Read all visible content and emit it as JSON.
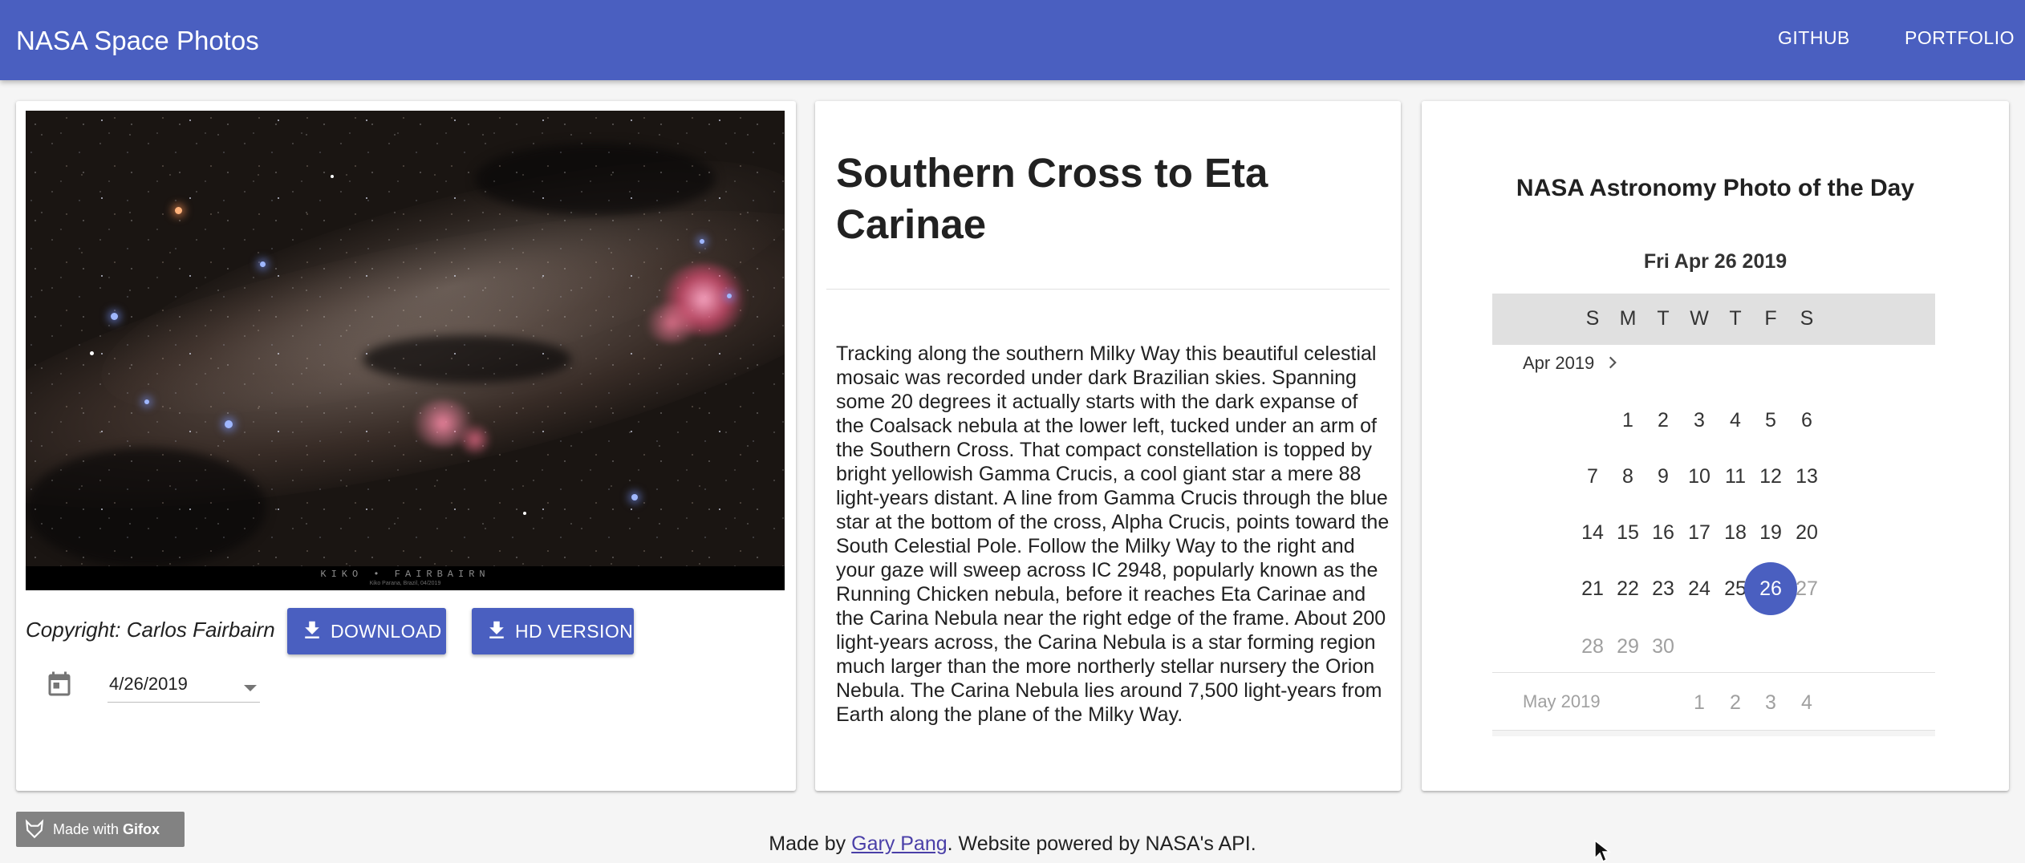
{
  "appbar": {
    "title": "NASA Space Photos",
    "links": [
      "GITHUB",
      "PORTFOLIO"
    ]
  },
  "photo_card": {
    "watermark": "KIKO • FAIRBAIRN",
    "watermark_sub": "Kiko Parana, Brazil, 04/2019",
    "copyright": "Copyright: Carlos Fairbairn",
    "download_label": "DOWNLOAD",
    "hd_label": "HD VERSION",
    "date_value": "4/26/2019"
  },
  "apod": {
    "title": "Southern Cross to Eta Carinae",
    "explanation": "Tracking along the southern Milky Way this beautiful celestial mosaic was recorded under dark Brazilian skies. Spanning some 20 degrees it actually starts with the dark expanse of the Coalsack nebula at the lower left, tucked under an arm of the Southern Cross. That compact constellation is topped by bright yellowish Gamma Crucis, a cool giant star a mere 88 light-years distant. A line from Gamma Crucis through the blue star at the bottom of the cross, Alpha Crucis, points toward the South Celestial Pole. Follow the Milky Way to the right and your gaze will sweep across IC 2948, popularly known as the Running Chicken nebula, before it reaches Eta Carinae and the Carina Nebula near the right edge of the frame. About 200 light-years across, the Carina Nebula is a star forming region much larger than the more northerly stellar nursery the Orion Nebula. The Carina Nebula lies around 7,500 light-years from Earth along the plane of the Milky Way."
  },
  "calendar": {
    "heading": "NASA Astronomy Photo of the Day",
    "selected_date_label": "Fri Apr 26 2019",
    "weekdays": [
      "S",
      "M",
      "T",
      "W",
      "T",
      "F",
      "S"
    ],
    "month_label": "Apr 2019",
    "weeks": [
      [
        "",
        "1",
        "2",
        "3",
        "4",
        "5",
        "6"
      ],
      [
        "7",
        "8",
        "9",
        "10",
        "11",
        "12",
        "13"
      ],
      [
        "14",
        "15",
        "16",
        "17",
        "18",
        "19",
        "20"
      ],
      [
        "21",
        "22",
        "23",
        "24",
        "25",
        "26",
        "27"
      ],
      [
        "28",
        "29",
        "30",
        "",
        "",
        "",
        ""
      ]
    ],
    "selected_day": "26",
    "dimmed_days": [
      "27",
      "28",
      "29",
      "30"
    ],
    "next_month_label": "May 2019",
    "next_month_days": [
      "",
      "",
      "",
      "1",
      "2",
      "3",
      "4"
    ],
    "accent_color": "#4a5fc0"
  },
  "footer": {
    "gifox_prefix": "Made with ",
    "gifox_brand": "Gifox",
    "made_by": "Made by ",
    "author": "Gary Pang",
    "powered": ". Website powered by NASA's API."
  },
  "icons": [
    "download-icon",
    "calendar-icon",
    "chevron-right-icon",
    "caret-down-icon",
    "fox-icon",
    "cursor-icon"
  ]
}
